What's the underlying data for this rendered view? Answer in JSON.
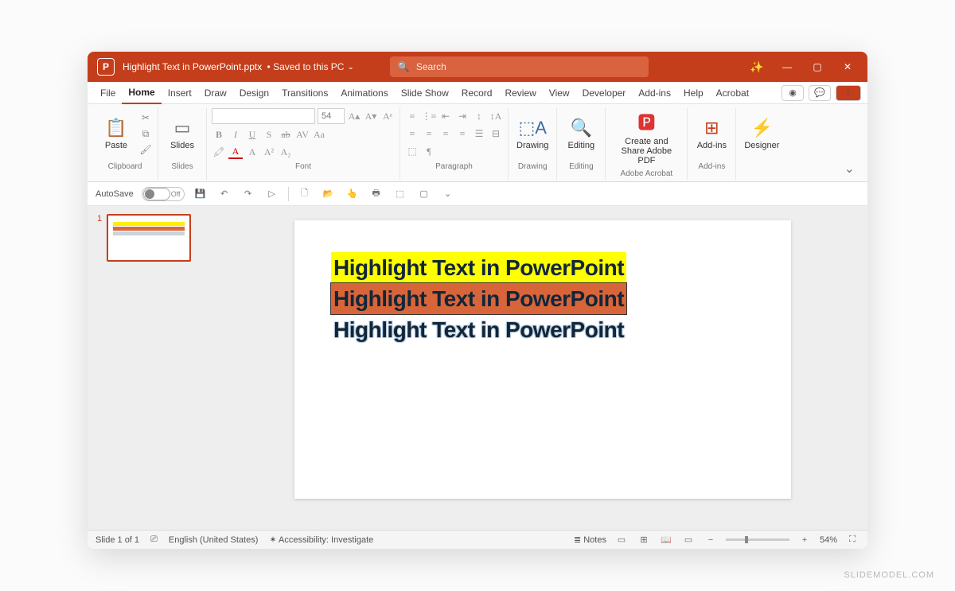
{
  "title": {
    "app_letter": "P",
    "document": "Highlight Text in PowerPoint.pptx",
    "save_status": "Saved to this PC"
  },
  "search": {
    "placeholder": "Search"
  },
  "tabs": [
    "File",
    "Home",
    "Insert",
    "Draw",
    "Design",
    "Transitions",
    "Animations",
    "Slide Show",
    "Record",
    "Review",
    "View",
    "Developer",
    "Add-ins",
    "Help",
    "Acrobat"
  ],
  "active_tab": "Home",
  "ribbon": {
    "clipboard": {
      "label": "Clipboard",
      "paste": "Paste"
    },
    "slides": {
      "label": "Slides",
      "btn": "Slides"
    },
    "font": {
      "label": "Font",
      "size": "54"
    },
    "paragraph": {
      "label": "Paragraph"
    },
    "drawing": {
      "label": "Drawing",
      "btn": "Drawing"
    },
    "editing": {
      "label": "Editing",
      "btn": "Editing"
    },
    "adobe": {
      "label": "Adobe Acrobat",
      "btn": "Create and Share Adobe PDF"
    },
    "addins": {
      "label": "Add-ins",
      "btn": "Add-ins"
    },
    "designer": {
      "label": "",
      "btn": "Designer"
    }
  },
  "qat": {
    "autosave": "AutoSave",
    "off": "Off"
  },
  "thumbnail": {
    "number": "1"
  },
  "slide": {
    "line1": "Highlight Text in PowerPoint",
    "line2": "Highlight Text in PowerPoint",
    "line3": "Highlight Text in PowerPoint"
  },
  "status": {
    "slide_count": "Slide 1 of 1",
    "language": "English (United States)",
    "accessibility": "Accessibility: Investigate",
    "notes": "Notes",
    "zoom": "54%"
  },
  "watermark": "SLIDEMODEL.COM",
  "glyphs": {
    "search": "🔍",
    "wand": "✨",
    "min": "—",
    "max": "▢",
    "close": "✕",
    "rec": "◉",
    "comment": "💬",
    "share": "⇧",
    "chev": "⌄",
    "scissors": "✂",
    "copy": "⧉",
    "brush": "🖌",
    "bold": "B",
    "italic": "I",
    "under": "U",
    "strike": "S",
    "shadow": "ab",
    "spacing": "AV",
    "grow": "A▴",
    "shrink": "A▾",
    "clear": "Aᵃ",
    "bullet": "≡",
    "number": "⋮≡",
    "indent": "⇤",
    "outdent": "⇥",
    "linesp": "↕",
    "align_l": "≡",
    "align_c": "≡",
    "align_r": "≡",
    "just": "≡",
    "cols": "☰",
    "dir": "¶",
    "undo": "↶",
    "redo": "↷",
    "save": "💾",
    "start": "▷",
    "new": "🗋",
    "open": "📂",
    "touch": "👆",
    "print": "🖶",
    "qa2": "⬚",
    "qa3": "▢",
    "person": "👤",
    "notes_ic": "≣",
    "normal": "▭",
    "sorter": "⊞",
    "reading": "📖",
    "show": "▭",
    "fit": "⛶",
    "minus": "−",
    "plus": "+"
  }
}
